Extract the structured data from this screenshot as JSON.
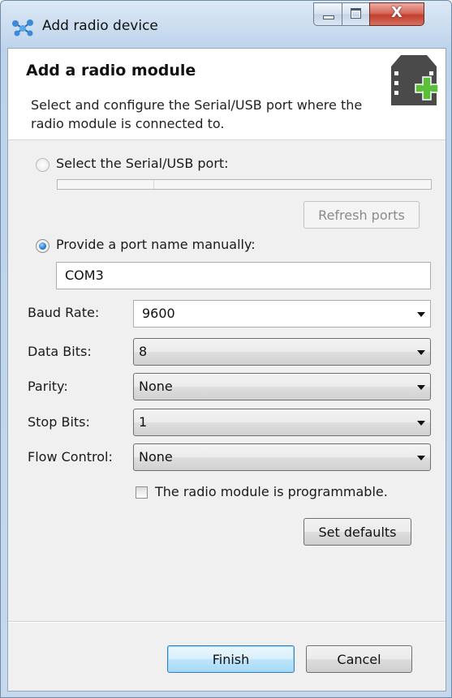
{
  "window": {
    "title": "Add radio device",
    "icons": [
      "network-nodes-icon",
      "minimize-icon",
      "maximize-icon",
      "close-icon"
    ],
    "close_glyph": "X"
  },
  "header": {
    "title": "Add a radio module",
    "description": "Select and configure the Serial/USB port where the radio module is connected to.",
    "icon": "radio-module-add-icon",
    "accent_color": "#5bbf3a"
  },
  "port_selection": {
    "select_serial_label": "Select the Serial/USB port:",
    "select_serial_checked": false,
    "refresh_button": "Refresh ports",
    "manual_label": "Provide a port name manually:",
    "manual_checked": true,
    "manual_value": "COM3"
  },
  "settings": {
    "baud_rate": {
      "label": "Baud Rate:",
      "value": "9600"
    },
    "data_bits": {
      "label": "Data Bits:",
      "value": "8"
    },
    "parity": {
      "label": "Parity:",
      "value": "None"
    },
    "stop_bits": {
      "label": "Stop Bits:",
      "value": "1"
    },
    "flow_control": {
      "label": "Flow Control:",
      "value": "None"
    }
  },
  "programmable": {
    "label": "The radio module is programmable.",
    "checked": false
  },
  "set_defaults_button": "Set defaults",
  "footer": {
    "finish_button": "Finish",
    "cancel_button": "Cancel"
  }
}
